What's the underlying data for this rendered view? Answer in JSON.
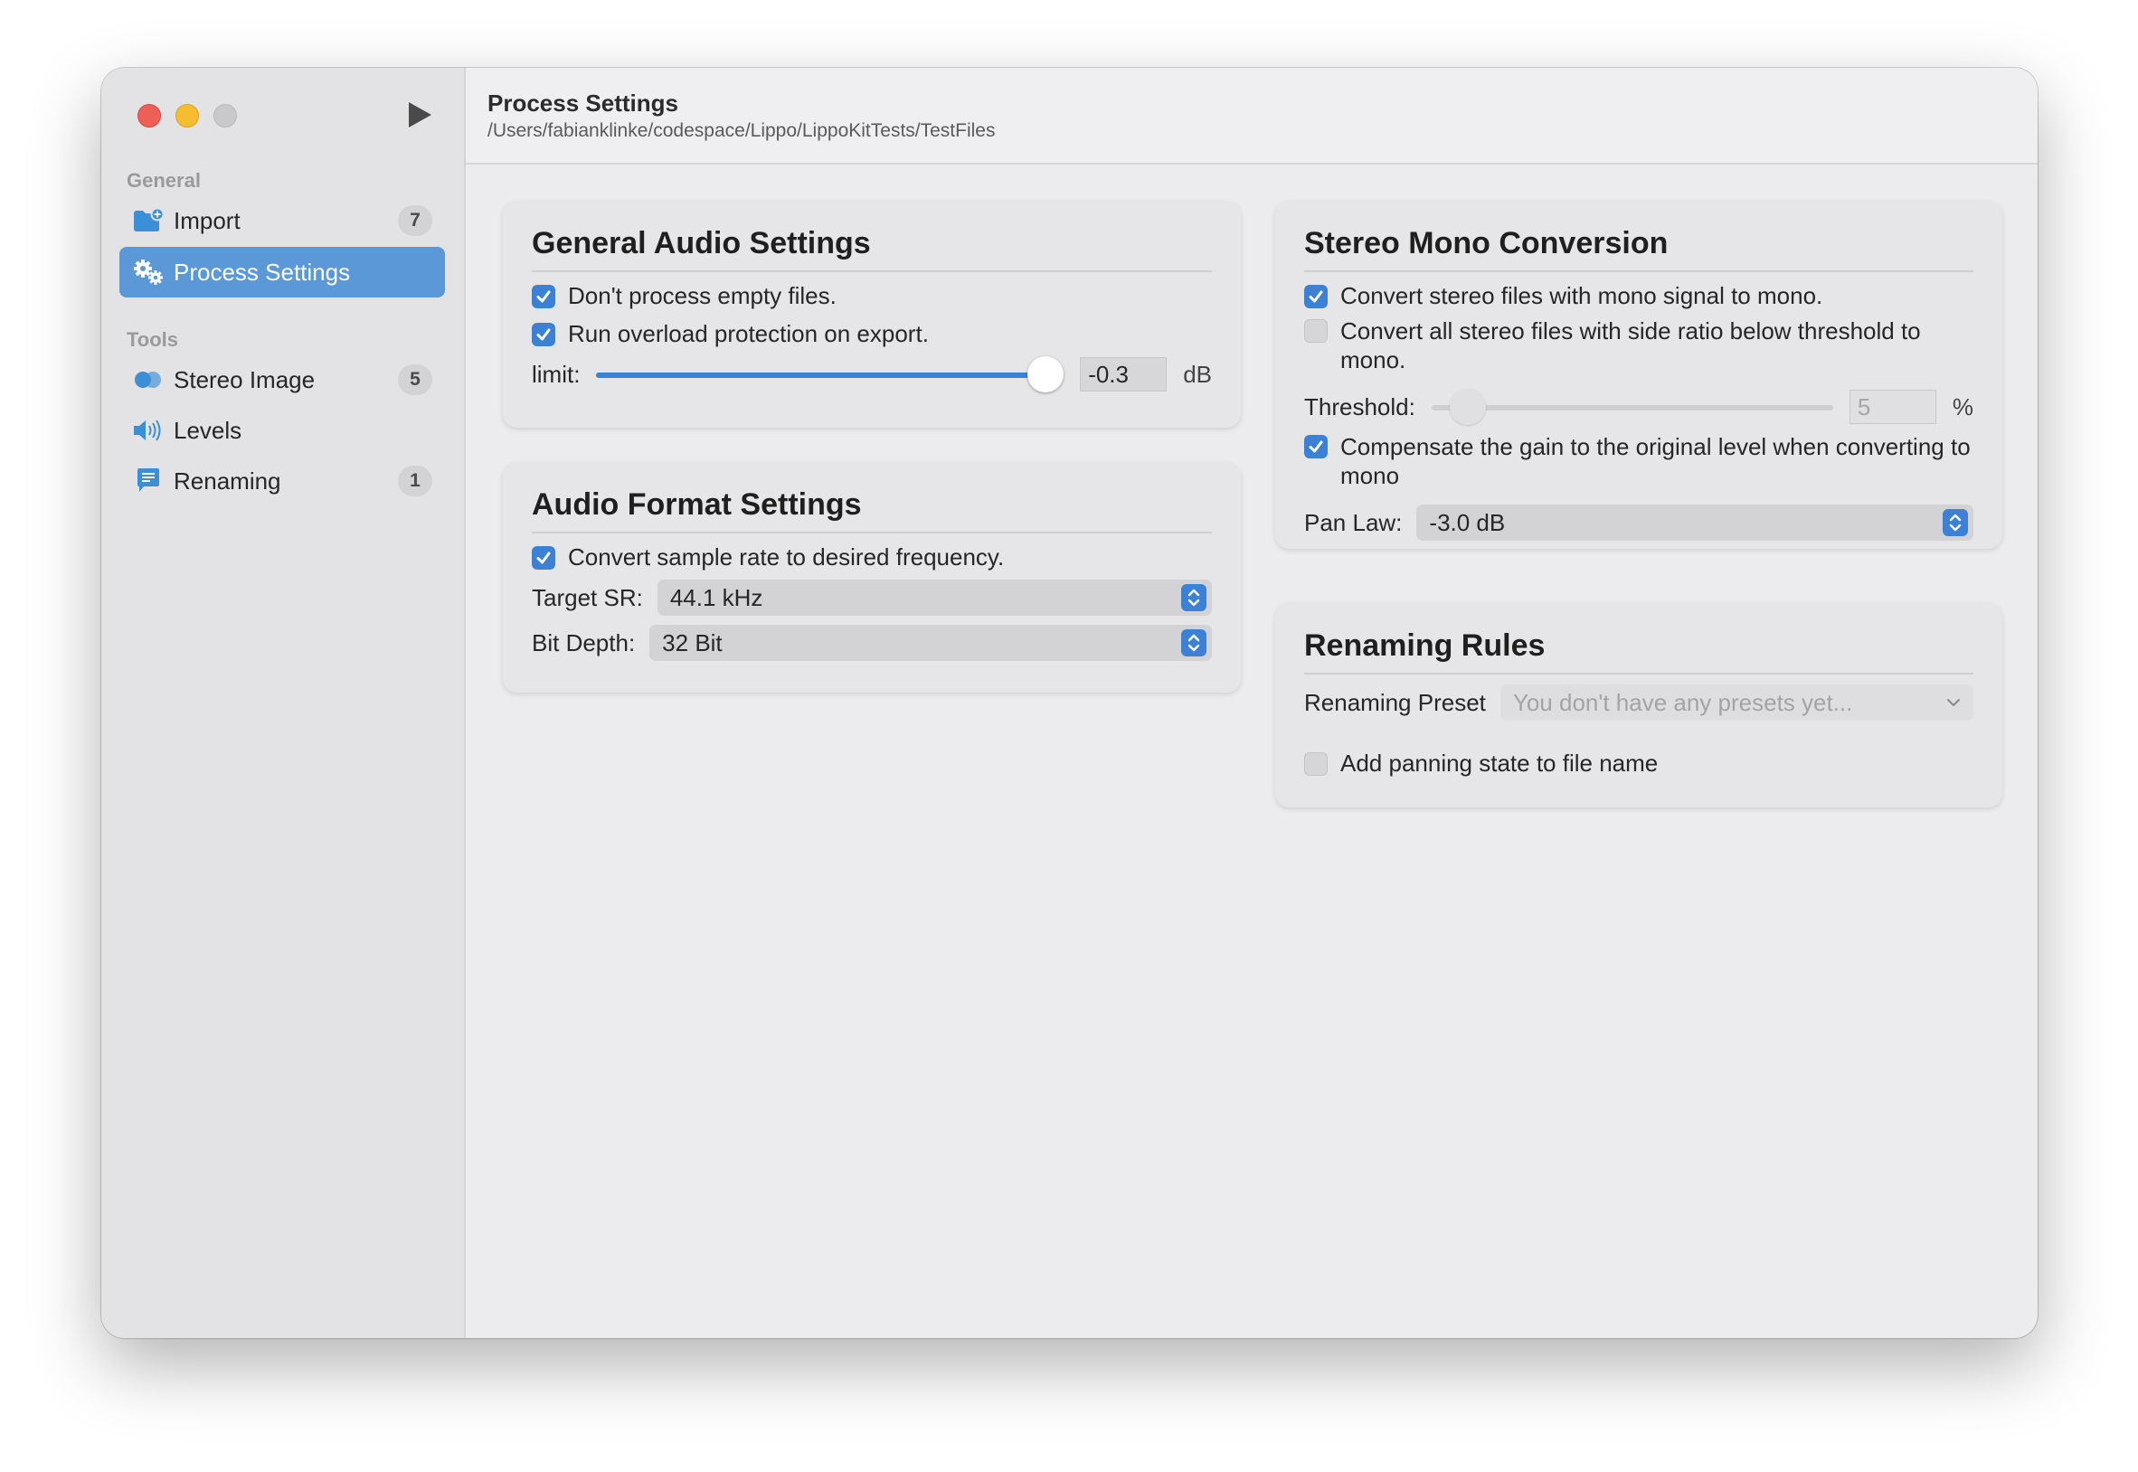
{
  "window": {
    "play_icon": "play-icon"
  },
  "sidebar": {
    "sections": [
      {
        "label": "General",
        "items": [
          {
            "label": "Import",
            "icon": "folder-plus-icon",
            "badge": "7",
            "active": false
          },
          {
            "label": "Process Settings",
            "icon": "gears-icon",
            "badge": "",
            "active": true
          }
        ]
      },
      {
        "label": "Tools",
        "items": [
          {
            "label": "Stereo Image",
            "icon": "stereo-circles-icon",
            "badge": "5",
            "active": false
          },
          {
            "label": "Levels",
            "icon": "speaker-icon",
            "badge": "",
            "active": false
          },
          {
            "label": "Renaming",
            "icon": "text-bubble-icon",
            "badge": "1",
            "active": false
          }
        ]
      }
    ]
  },
  "header": {
    "title": "Process Settings",
    "path": "/Users/fabianklinke/codespace/Lippo/LippoKitTests/TestFiles"
  },
  "general_audio": {
    "title": "General Audio Settings",
    "empty_files_label": "Don't process empty files.",
    "empty_files_checked": true,
    "overload_label": "Run overload protection on export.",
    "overload_checked": true,
    "limit_label": "limit:",
    "limit_value": "-0.3",
    "limit_unit": "dB"
  },
  "audio_format": {
    "title": "Audio Format Settings",
    "convert_sr_label": "Convert sample rate to desired frequency.",
    "convert_sr_checked": true,
    "target_sr_label": "Target SR:",
    "target_sr_value": "44.1 kHz",
    "bit_depth_label": "Bit Depth:",
    "bit_depth_value": "32 Bit"
  },
  "stereo_mono": {
    "title": "Stereo Mono Conversion",
    "convert_mono_label": "Convert stereo files with mono signal to mono.",
    "convert_mono_checked": true,
    "side_ratio_label": "Convert all stereo files with side ratio below threshold to mono.",
    "side_ratio_checked": false,
    "threshold_label": "Threshold:",
    "threshold_value": "5",
    "threshold_unit": "%",
    "compensate_label": "Compensate the gain to the original level when converting to mono",
    "compensate_checked": true,
    "pan_law_label": "Pan Law:",
    "pan_law_value": "-3.0 dB"
  },
  "renaming_rules": {
    "title": "Renaming Rules",
    "preset_label": "Renaming Preset",
    "preset_placeholder": "You don't have any presets yet...",
    "panning_label": "Add panning state to file name",
    "panning_checked": false
  },
  "colors": {
    "accent": "#3b82d6",
    "sidebar_selection": "#5b98d8",
    "close": "#ee5f57",
    "minimize": "#f5bd2f",
    "zoom_inactive": "#c9c9cb"
  }
}
